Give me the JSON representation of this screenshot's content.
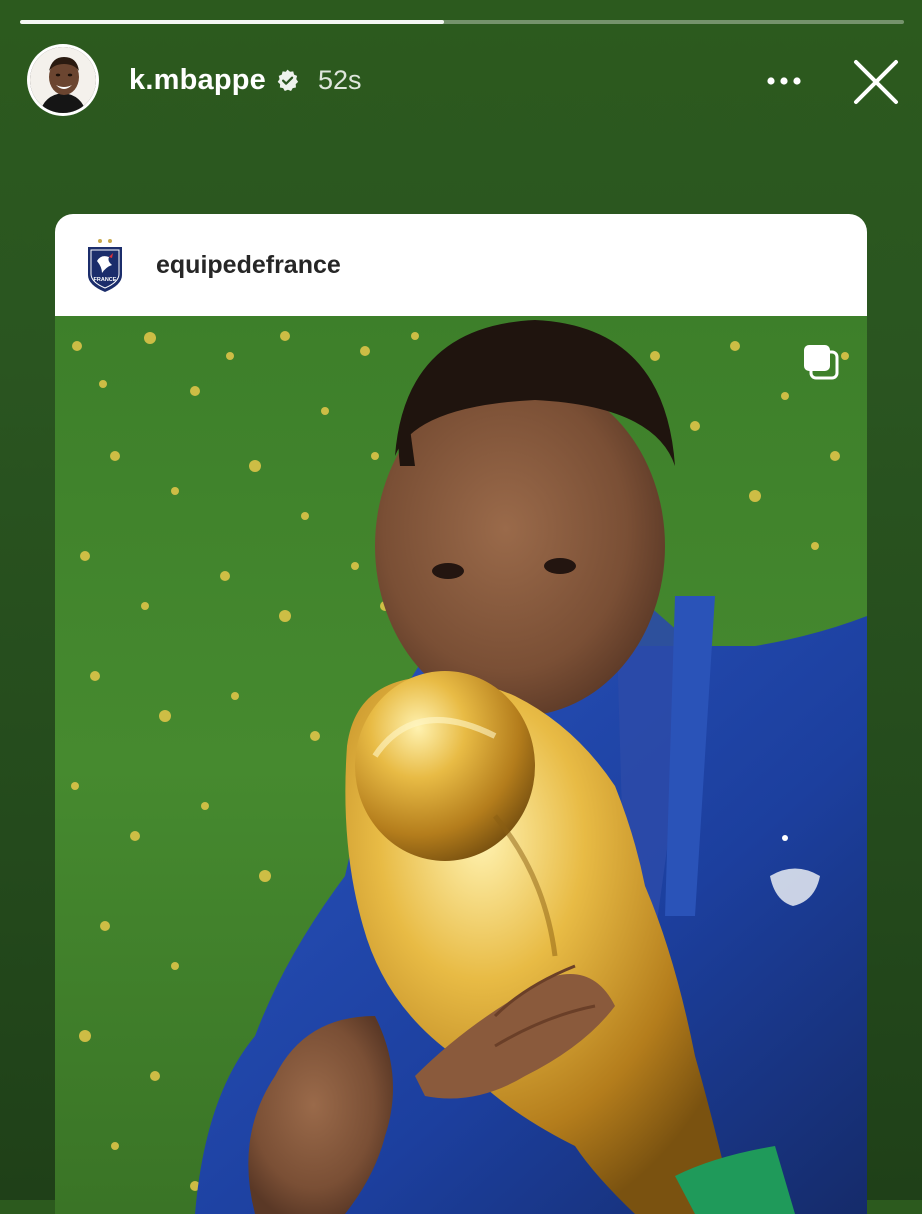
{
  "story": {
    "progress": 0.48,
    "username": "k.mbappe",
    "verified": true,
    "timestamp": "52s",
    "icons": {
      "more": "more-horizontal-icon",
      "close": "close-icon",
      "verified": "verified-badge-icon"
    }
  },
  "shared_post": {
    "author": "equipedefrance",
    "logo_text": "FRANCE",
    "icons": {
      "carousel": "carousel-icon"
    }
  },
  "colors": {
    "background_green": "#2a5520",
    "card_white": "#ffffff",
    "author_text": "#262626",
    "jersey_blue": "#1c3f9e",
    "trophy_gold": "#d9a52c"
  }
}
